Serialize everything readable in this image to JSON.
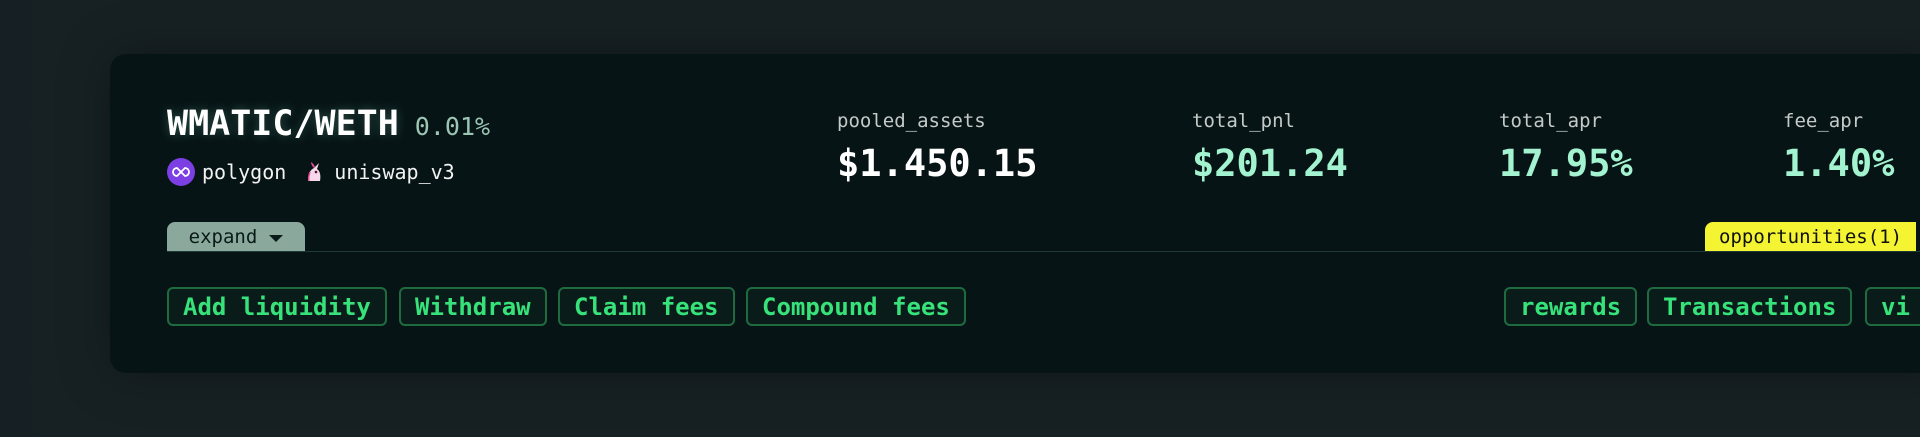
{
  "pair": {
    "name": "WMATIC/WETH",
    "fee_tier": "0.01%"
  },
  "chain": {
    "name": "polygon",
    "icon": "polygon-icon",
    "color": "#7b3fe4"
  },
  "dex": {
    "name": "uniswap_v3",
    "icon": "unicorn-icon"
  },
  "stats": [
    {
      "label": "pooled_assets",
      "value": "$1.450.15"
    },
    {
      "label": "total_pnl",
      "value": "$201.24"
    },
    {
      "label": "total_apr",
      "value": "17.95%"
    },
    {
      "label": "fee_apr",
      "value": "1.40%"
    }
  ],
  "expand_label": "expand",
  "opportunities_label": "opportunities(1)",
  "actions": [
    "Add liquidity",
    "Withdraw",
    "Claim fees",
    "Compound fees"
  ],
  "tabs": [
    "rewards",
    "Transactions",
    "vi"
  ],
  "colors": {
    "accent_green": "#37e27a",
    "value_mint": "#a3f3d0",
    "opportunity_yellow": "#f4f432",
    "card_bg": "#071416",
    "page_bg": "#172124"
  }
}
